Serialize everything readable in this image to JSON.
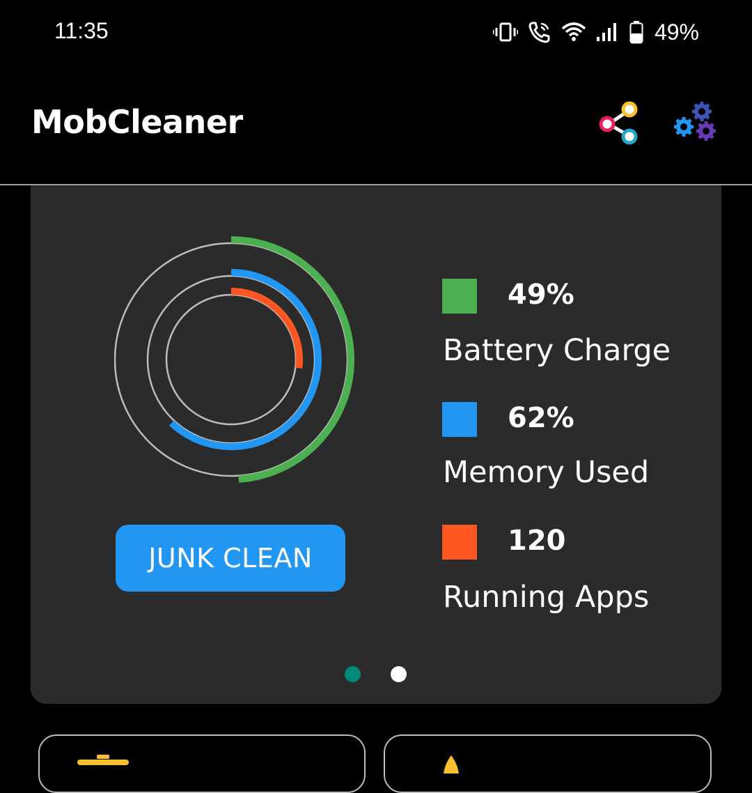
{
  "status_bar": {
    "time": "11:35",
    "battery_percent": "49%",
    "icons": [
      "vibrate-icon",
      "wifi-calling-icon",
      "wifi-icon",
      "signal-icon",
      "battery-icon"
    ]
  },
  "app_bar": {
    "title": "MobCleaner",
    "actions": [
      "share-icon",
      "settings-gears-icon"
    ]
  },
  "dashboard": {
    "rings": {
      "battery_fraction": 0.49,
      "memory_fraction": 0.62,
      "apps_fraction": 0.27
    },
    "junk_clean_label": "JUNK CLEAN",
    "stats": [
      {
        "value": "49%",
        "label": "Battery Charge",
        "color": "#4caf50"
      },
      {
        "value": "62%",
        "label": "Memory Used",
        "color": "#2196f3"
      },
      {
        "value": "120",
        "label": "Running Apps",
        "color": "#ff5722"
      }
    ],
    "pager": {
      "pages": 2,
      "active": 0,
      "active_color": "#00897b",
      "inactive_color": "#ffffff"
    }
  },
  "colors": {
    "background": "#000000",
    "card": "#2b2b2b",
    "accent_blue": "#2196f3",
    "green": "#4caf50",
    "orange": "#ff5722",
    "track": "#bdbdbd"
  }
}
